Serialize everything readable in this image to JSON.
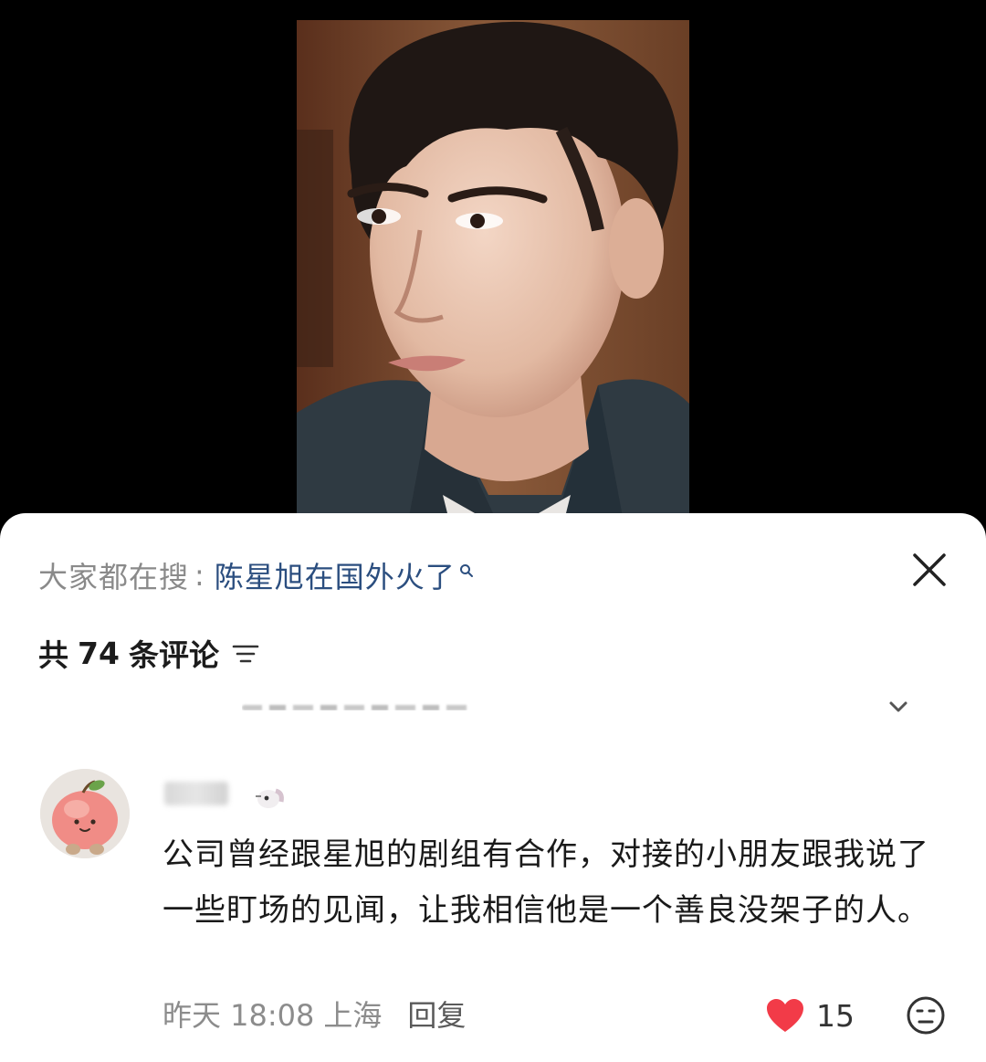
{
  "search_suggestion": {
    "prefix": "大家都在搜",
    "separator": ":",
    "query": "陈星旭在国外火了"
  },
  "comments_header": {
    "count_prefix": "共",
    "count": "74",
    "count_suffix": "条评论"
  },
  "comment": {
    "text": "公司曾经跟星旭的剧组有合作，对接的小朋友跟我说了一些盯场的见闻，让我相信他是一个善良没架子的人。",
    "time": "昨天 18:08",
    "location": "上海",
    "reply_label": "回复",
    "likes": "15"
  },
  "colors": {
    "link": "#2b4e7f",
    "like_heart": "#f23b48",
    "muted_text": "#8a8a8a"
  },
  "icons": {
    "close": "close-icon",
    "sort": "sort-icon",
    "search_small": "search-icon",
    "expand": "chevron-down-icon",
    "like": "heart-icon",
    "emoji": "emoji-icon"
  }
}
